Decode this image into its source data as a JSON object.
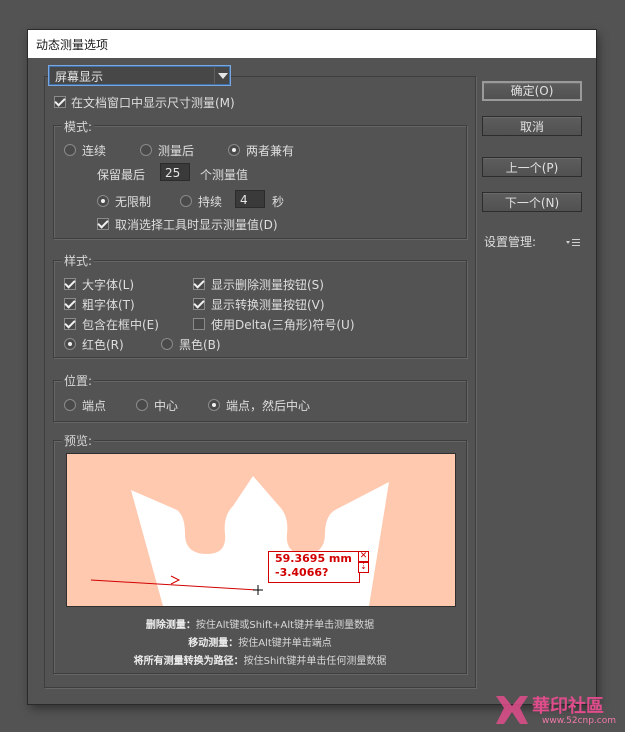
{
  "window": {
    "title": "动态测量选项"
  },
  "display_dropdown": {
    "value": "屏幕显示"
  },
  "show_in_window": {
    "label": "在文档窗口中显示尺寸测量(M)",
    "checked": true
  },
  "mode": {
    "group_label": "模式:",
    "options": [
      "连续",
      "测量后",
      "两者兼有"
    ],
    "selected": "两者兼有",
    "keep_last_prefix": "保留最后",
    "keep_last_value": "25",
    "keep_last_suffix": "个测量值",
    "duration_options": [
      "无限制",
      "持续"
    ],
    "duration_selected": "无限制",
    "duration_value": "4",
    "duration_unit": "秒",
    "deselect_label": "取消选择工具时显示测量值(D)",
    "deselect_checked": true
  },
  "style": {
    "group_label": "样式:",
    "large_font": "大字体(L)",
    "bold_font": "粗字体(T)",
    "in_frame": "包含在框中(E)",
    "show_delete": "显示删除测量按钮(S)",
    "show_convert": "显示转换测量按钮(V)",
    "use_delta": "使用Delta(三角形)符号(U)",
    "color_options": [
      "红色(R)",
      "黑色(B)"
    ],
    "color_selected": "红色(R)"
  },
  "position": {
    "group_label": "位置:",
    "options": [
      "端点",
      "中心",
      "端点，然后中心"
    ],
    "selected": "端点，然后中心"
  },
  "preview": {
    "group_label": "预览:",
    "measure_value": "59.3695 mm",
    "measure_angle": "-3.4066?",
    "close_icon": "close-icon",
    "convert_icon": "convert-icon"
  },
  "instructions": [
    {
      "bold": "删除测量：",
      "text": "按住Alt键或Shift+Alt键并单击测量数据"
    },
    {
      "bold": "移动测量：",
      "text": "按住Alt键并单击端点"
    },
    {
      "bold": "将所有测量转换为路径：",
      "text": "按住Shift键并单击任何测量数据"
    }
  ],
  "buttons": {
    "ok": "确定(O)",
    "cancel": "取消",
    "prev": "上一个(P)",
    "next": "下一个(N)"
  },
  "preset": {
    "label": "设置管理:",
    "icon": "list-menu-icon"
  },
  "watermark": {
    "brand": "華印社區",
    "url": "www.52cnp.com"
  }
}
